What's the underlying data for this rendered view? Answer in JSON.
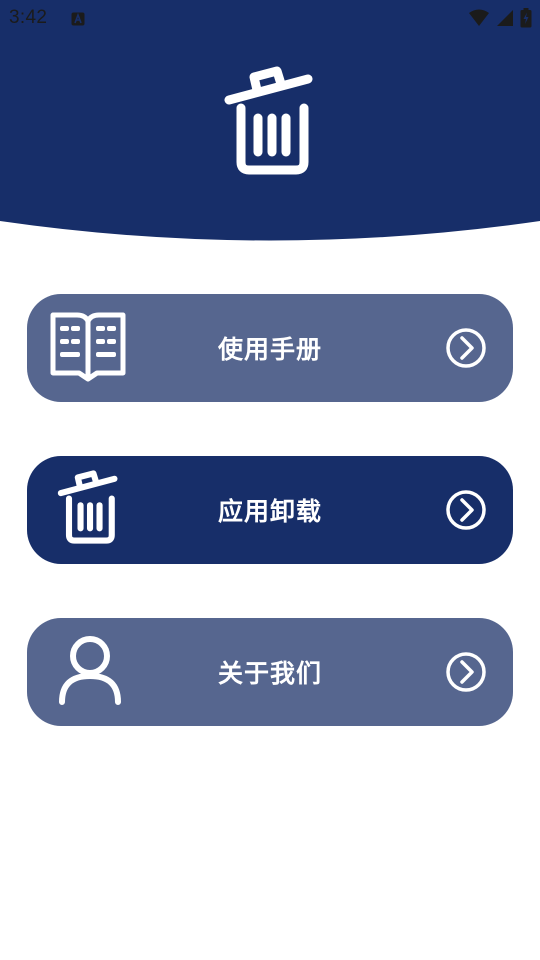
{
  "status_bar": {
    "time": "3:42",
    "icons": [
      "notification-a-icon",
      "wifi-icon",
      "signal-icon",
      "battery-charging-icon"
    ]
  },
  "header": {
    "icon": "trash-icon",
    "background_color": "#172e69"
  },
  "menu": [
    {
      "label": "使用手册",
      "icon": "book-icon",
      "color": "#56668f"
    },
    {
      "label": "应用卸载",
      "icon": "trash-icon",
      "color": "#172e69"
    },
    {
      "label": "关于我们",
      "icon": "person-icon",
      "color": "#56668f"
    }
  ]
}
